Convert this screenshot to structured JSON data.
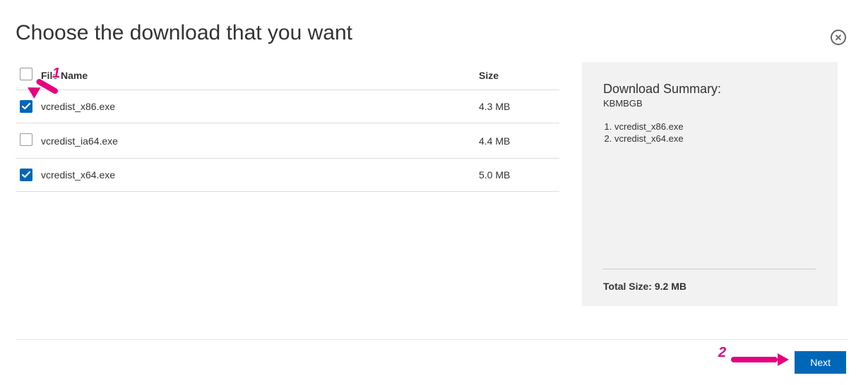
{
  "title": "Choose the download that you want",
  "table": {
    "col_name": "File Name",
    "col_size": "Size",
    "select_all_checked": false,
    "rows": [
      {
        "name": "vcredist_x86.exe",
        "size": "4.3 MB",
        "checked": true
      },
      {
        "name": "vcredist_ia64.exe",
        "size": "4.4 MB",
        "checked": false
      },
      {
        "name": "vcredist_x64.exe",
        "size": "5.0 MB",
        "checked": true
      }
    ]
  },
  "summary": {
    "heading": "Download Summary:",
    "unit_line": "KBMBGB",
    "items": [
      "vcredist_x86.exe",
      "vcredist_x64.exe"
    ],
    "total_label": "Total Size:",
    "total_value": "9.2 MB"
  },
  "next_label": "Next",
  "annotations": {
    "a1": "1",
    "a2": "2"
  }
}
